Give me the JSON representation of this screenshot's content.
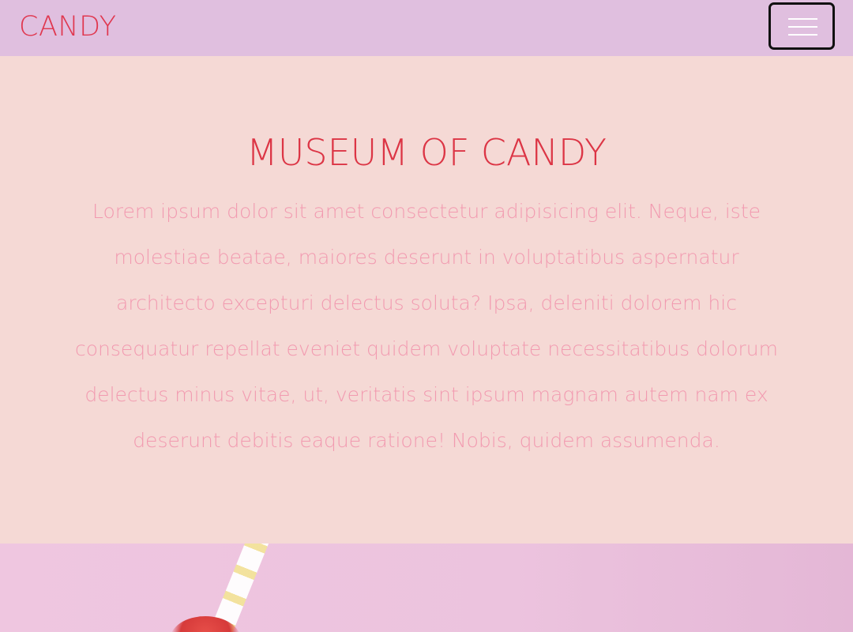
{
  "navbar": {
    "brand": "CANDY",
    "toggler_icon": "hamburger-menu-icon"
  },
  "hero": {
    "title": "MUSEUM OF CANDY",
    "paragraph": "Lorem ipsum dolor sit amet consectetur adipisicing elit. Neque, iste molestiae beatae, maiores deserunt in voluptatibus aspernatur architecto excepturi delectus soluta? Ipsa, deleniti dolorem hic consequatur repellat eveniet quidem voluptate necessitatibus dolorum delectus minus vitae, ut, veritatis sint ipsum magnam autem nam ex deserunt debitis eaque ratione! Nobis, quidem assumenda."
  },
  "colors": {
    "navbar_bg": "#e0bfdf",
    "hero_bg": "#f5d9d5",
    "title": "#dc3545",
    "paragraph": "#f29ab0"
  }
}
